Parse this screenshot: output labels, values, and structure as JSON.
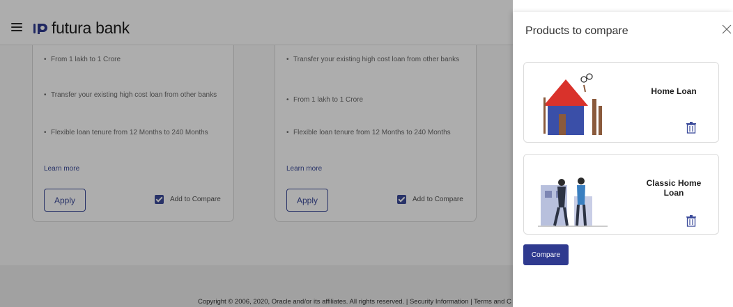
{
  "header": {
    "brand": "futura bank",
    "logo_icon": "futura-logo-icon",
    "menu_icon": "hamburger-icon"
  },
  "products": [
    {
      "bullets": [
        "From 1 lakh to 1 Crore",
        "Transfer your existing high cost loan from other banks",
        "Flexible loan tenure from 12 Months to 240 Months"
      ],
      "learn_more": "Learn more",
      "apply_label": "Apply",
      "compare_label": "Add to Compare",
      "compare_checked": true
    },
    {
      "bullets": [
        "Transfer your existing high cost loan from other banks",
        "From 1 lakh to 1 Crore",
        "Flexible loan tenure from 12 Months to 240 Months"
      ],
      "learn_more": "Learn more",
      "apply_label": "Apply",
      "compare_label": "Add to Compare",
      "compare_checked": true
    }
  ],
  "footer": {
    "copyright": "Copyright © 2006, 2020, Oracle and/or its affiliates. All rights reserved. | Security Information | Terms and Conditions"
  },
  "compare_panel": {
    "title": "Products to compare",
    "close_icon": "close-icon",
    "items": [
      {
        "name": "Home Loan",
        "image": "house-illustration",
        "remove_icon": "trash-icon"
      },
      {
        "name": "Classic Home Loan",
        "image": "couple-house-illustration",
        "remove_icon": "trash-icon"
      }
    ],
    "compare_button": "Compare"
  },
  "colors": {
    "accent": "#2f3a8f",
    "link": "#3b4b9a",
    "overlay": "rgba(0,0,0,0.32)"
  }
}
